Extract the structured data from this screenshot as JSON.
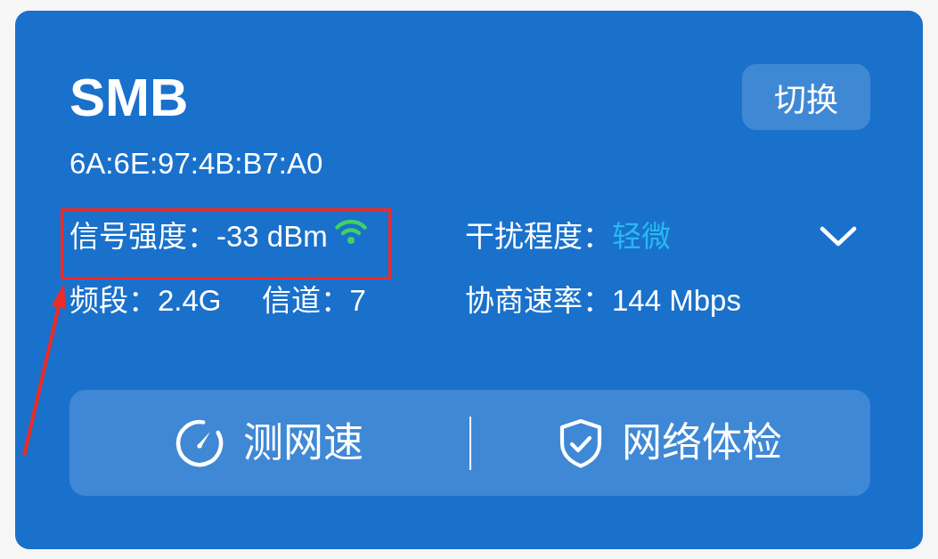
{
  "network": {
    "name": "SMB",
    "mac": "6A:6E:97:4B:B7:A0"
  },
  "switch_button": {
    "label": "切换"
  },
  "details": [
    {
      "items": [
        {
          "label": "信号强度：",
          "value": "-33 dBm",
          "kind": "signal"
        }
      ]
    },
    {
      "items": [
        {
          "label": "干扰程度：",
          "value": "轻微",
          "kind": "rating",
          "color": "#29b8f2"
        }
      ]
    },
    {
      "items": [
        {
          "label": "频段：",
          "value": "2.4G",
          "kind": "plain"
        },
        {
          "label": "信道：",
          "value": "7",
          "kind": "plain"
        }
      ]
    },
    {
      "items": [
        {
          "label": "协商速率：",
          "value": "144 Mbps",
          "kind": "plain"
        }
      ]
    }
  ],
  "expanded": false,
  "actions": [
    {
      "label": "测网速",
      "kind": "speed"
    },
    {
      "label": "网络体检",
      "kind": "checkup"
    }
  ]
}
